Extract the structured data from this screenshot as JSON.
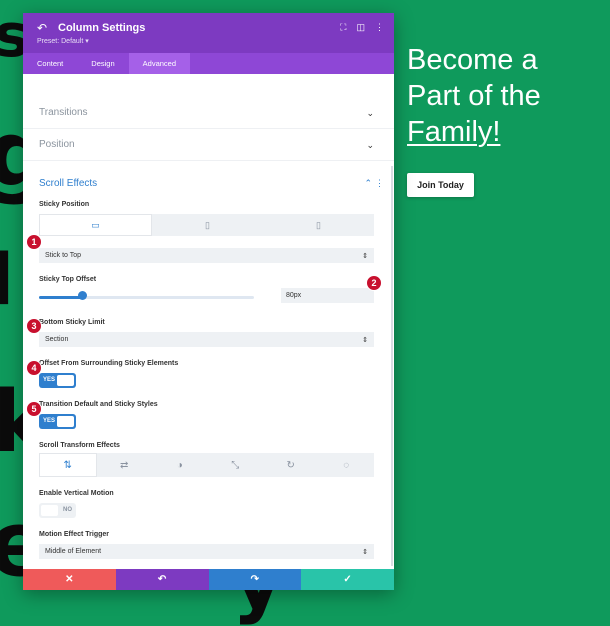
{
  "background": {
    "color": "#0f9a5c",
    "decor_glyphs": [
      "s",
      "g",
      "l",
      "k",
      "e",
      "y"
    ]
  },
  "hero": {
    "line1": "Become a",
    "line2": "Part of the",
    "line3_word": "Family!",
    "cta_label": "Join Today"
  },
  "panel": {
    "header": {
      "title": "Column Settings",
      "preset": "Preset: Default ▾",
      "icons": [
        "back-arrow-icon",
        "expand-icon",
        "split-view-icon",
        "more-icon"
      ],
      "colors": {
        "header": "#7d3ac1",
        "tabs": "#8e47d6",
        "active_tab": "#a560e8"
      }
    },
    "tabs": [
      {
        "label": "Content",
        "active": false
      },
      {
        "label": "Design",
        "active": false
      },
      {
        "label": "Advanced",
        "active": true
      }
    ],
    "collapsed_sections": [
      "Transitions",
      "Position"
    ],
    "scroll_effects": {
      "title": "Scroll Effects",
      "accent": "#2f7fce",
      "sticky_position": {
        "label": "Sticky Position",
        "devices": [
          "desktop-icon",
          "tablet-icon",
          "phone-icon"
        ],
        "active_device": "desktop",
        "value": "Stick to Top"
      },
      "sticky_top_offset": {
        "label": "Sticky Top Offset",
        "value": "80px",
        "slider_fraction": 0.2
      },
      "bottom_sticky_limit": {
        "label": "Bottom Sticky Limit",
        "value": "Section"
      },
      "offset_surrounding": {
        "label": "Offset From Surrounding Sticky Elements",
        "toggle": "YES"
      },
      "transition_default": {
        "label": "Transition Default and Sticky Styles",
        "toggle": "YES"
      },
      "scroll_transform": {
        "label": "Scroll Transform Effects",
        "effects": [
          "vertical-motion-icon",
          "horizontal-motion-icon",
          "fade-icon",
          "scale-icon",
          "rotate-icon",
          "blur-icon"
        ],
        "active": "vertical-motion"
      },
      "vertical_motion": {
        "label": "Enable Vertical Motion",
        "toggle": "NO"
      },
      "motion_trigger": {
        "label": "Motion Effect Trigger",
        "value": "Middle of Element"
      }
    },
    "footer": {
      "buttons": [
        {
          "action": "cancel",
          "glyph": "✕",
          "color": "#ef5a5a"
        },
        {
          "action": "undo",
          "glyph": "↶",
          "color": "#7d3ac1"
        },
        {
          "action": "redo",
          "glyph": "↷",
          "color": "#2f7fce"
        },
        {
          "action": "save",
          "glyph": "✓",
          "color": "#29c4a9"
        }
      ]
    }
  },
  "callouts": [
    "1",
    "2",
    "3",
    "4",
    "5"
  ],
  "callout_color": "#c8102e"
}
